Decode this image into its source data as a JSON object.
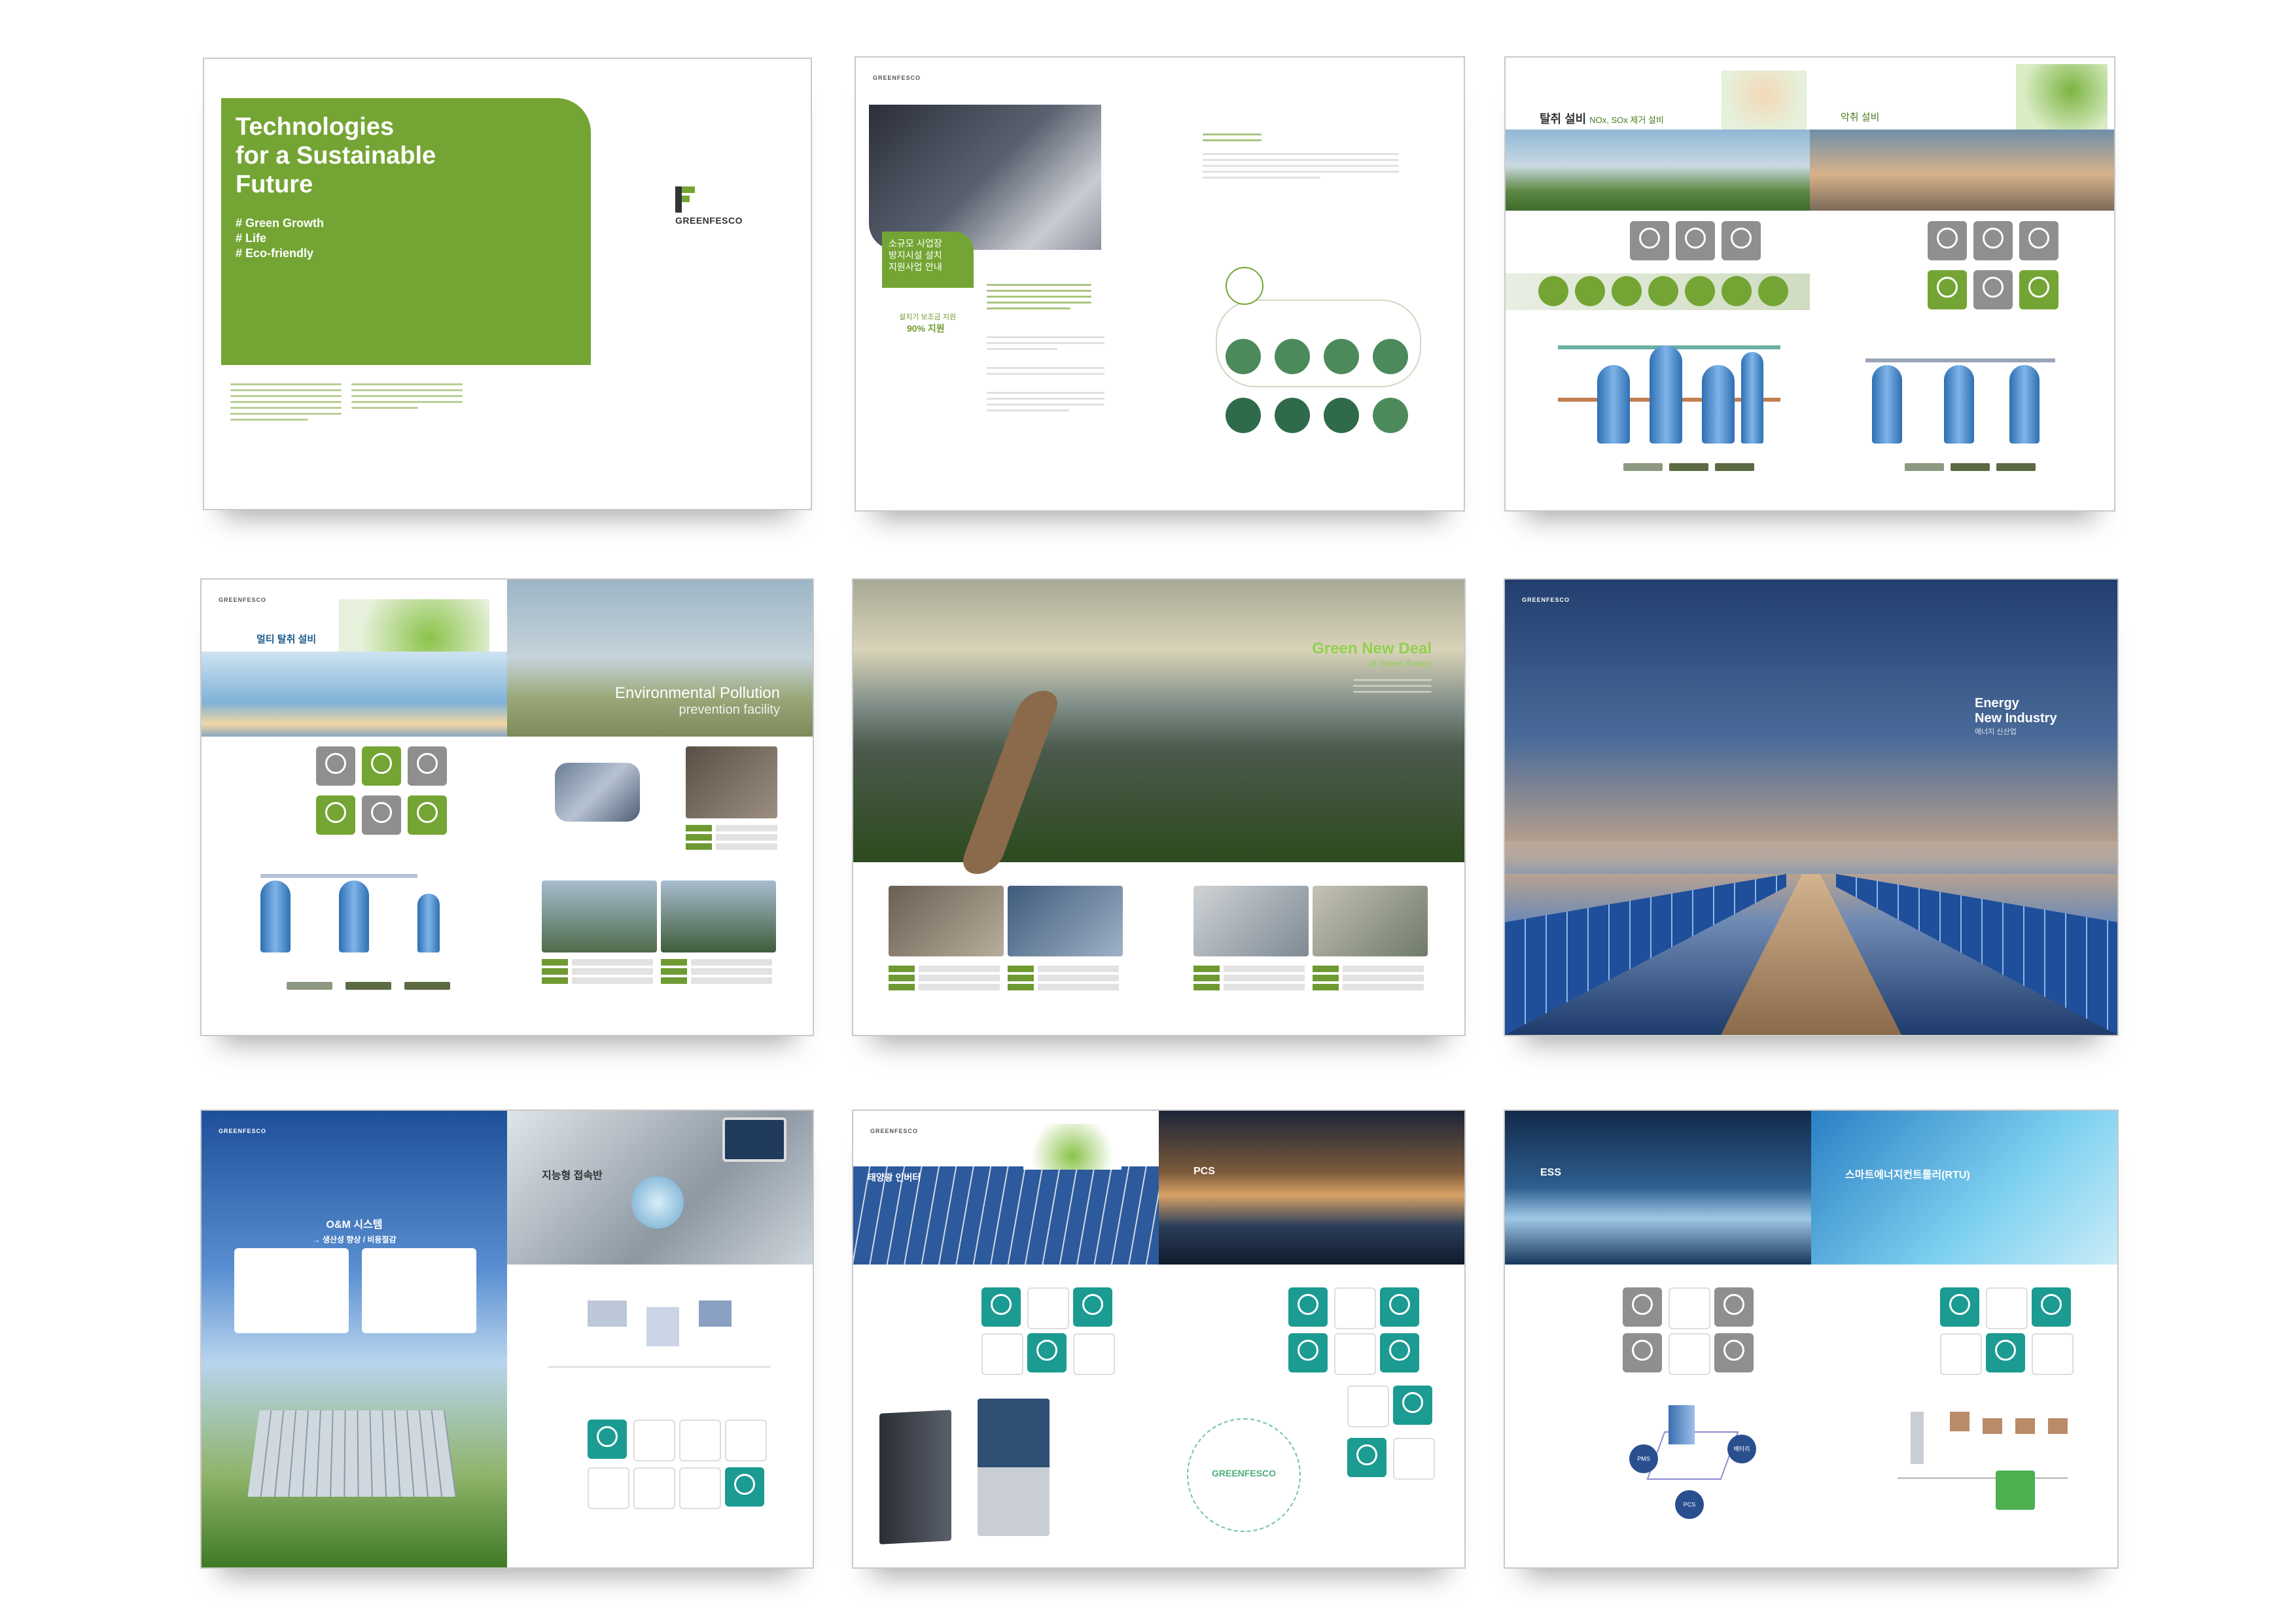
{
  "cover": {
    "title_line1": "Technologies",
    "title_line2": "for a Sustainable",
    "title_line3": "Future",
    "tag1": "# Green Growth",
    "tag2": "# Life",
    "tag3": "# Eco-friendly",
    "logo_text": "GREENFESCO"
  },
  "spread2": {
    "vertical_title": "소규모 사업장\n방지시설 설치\n지원사업 안내",
    "support_label": "설치기 보조금 지원",
    "support_value": "90% 지원"
  },
  "spread3": {
    "section1_title": "탈취 설비",
    "section1_sub": "NOx, SOx 제거 설비",
    "section2_title": "악취 설비"
  },
  "spread4": {
    "section_title": "멀티 탈취 설비",
    "banner_line1": "Environmental Pollution",
    "banner_line2": "prevention facility"
  },
  "spread5": {
    "title_line1": "Green New Deal",
    "title_line2": "of Green Fesco"
  },
  "spread6": {
    "title_line1": "Energy",
    "title_line2": "New Industry",
    "subtitle": "에너지 신산업"
  },
  "spread7": {
    "left_title": "O&M 시스템",
    "left_sub": "→ 생산성 향상 / 비용절감",
    "right_title": "지능형 접속반"
  },
  "spread8": {
    "left_title": "태양광 인버터",
    "right_title": "PCS",
    "logo_text": "GREENFESCO"
  },
  "spread9": {
    "left_title": "ESS",
    "right_title": "스마트에너지컨트롤러(RTU)",
    "node_pms": "PMS",
    "node_pcs": "PCS",
    "node_battery": "배터리"
  },
  "small_logo": "GREENFESCO",
  "colors": {
    "green": "#74a534",
    "teal": "#1b9b91",
    "navy": "#1e3a6b"
  }
}
